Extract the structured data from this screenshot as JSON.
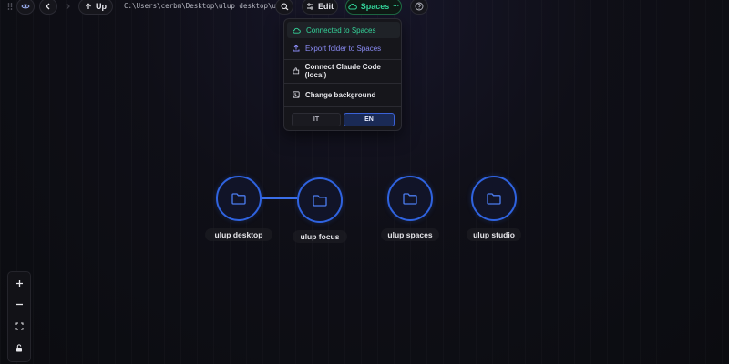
{
  "toolbar": {
    "up_label": "Up",
    "path": "C:\\Users\\cerbm\\Desktop\\ulup desktop\\ul…",
    "edit_label": "Edit",
    "spaces_label": "Spaces",
    "spaces_more": "···"
  },
  "dropdown": {
    "connected": "Connected to Spaces",
    "export": "Export folder to Spaces",
    "claude": "Connect Claude Code (local)",
    "background": "Change background",
    "lang_it": "IT",
    "lang_en": "EN",
    "selected_lang": "EN"
  },
  "nodes": [
    {
      "label": "ulup desktop"
    },
    {
      "label": "ulup focus"
    },
    {
      "label": "ulup spaces"
    },
    {
      "label": "ulup studio"
    }
  ],
  "colors": {
    "accent_green": "#34d399",
    "accent_blue": "#2f63e0",
    "accent_purple": "#8b8cf6"
  }
}
